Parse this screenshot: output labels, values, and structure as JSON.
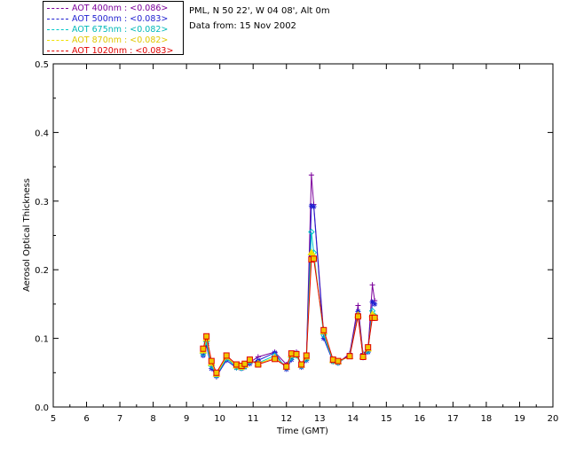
{
  "station": {
    "title": "PML, N 50 22', W 04 08', Alt 0m",
    "date": "Data from: 15 Nov 2002"
  },
  "colors": {
    "400nm": "#7b009b",
    "500nm": "#1f1fd0",
    "675nm": "#00c8c8",
    "870nm": "#f0e000",
    "1020nm": "#e00000"
  },
  "chart_data": {
    "type": "line",
    "xlabel": "Time (GMT)",
    "ylabel": "Aerosol Optical Thickness",
    "xlim": [
      5,
      20
    ],
    "ylim": [
      0.0,
      0.5
    ],
    "x_ticks": [
      "5",
      "6",
      "7",
      "8",
      "9",
      "10",
      "11",
      "12",
      "13",
      "14",
      "15",
      "16",
      "17",
      "18",
      "19",
      "20"
    ],
    "y_ticks": [
      "0.0",
      "0.1",
      "0.2",
      "0.3",
      "0.4",
      "0.5"
    ],
    "x": [
      9.5,
      9.6,
      9.75,
      9.9,
      10.2,
      10.5,
      10.65,
      10.75,
      10.9,
      11.15,
      11.65,
      12.0,
      12.15,
      12.3,
      12.45,
      12.6,
      12.75,
      12.82,
      13.12,
      13.4,
      13.55,
      13.9,
      14.15,
      14.3,
      14.45,
      14.58,
      14.65
    ],
    "series": [
      {
        "name": "AOT  400nm : <0.086>",
        "symbol": "+",
        "values": [
          0.08,
          0.092,
          0.062,
          0.044,
          0.07,
          0.062,
          0.057,
          0.063,
          0.065,
          0.073,
          0.08,
          0.062,
          0.074,
          0.08,
          0.06,
          0.073,
          0.338,
          0.295,
          0.106,
          0.066,
          0.064,
          0.078,
          0.148,
          0.078,
          0.084,
          0.178,
          0.155
        ]
      },
      {
        "name": "AOT  500nm : <0.083>",
        "symbol": "*",
        "values": [
          0.075,
          0.09,
          0.056,
          0.045,
          0.068,
          0.057,
          0.056,
          0.058,
          0.063,
          0.068,
          0.079,
          0.055,
          0.069,
          0.079,
          0.058,
          0.068,
          0.293,
          0.292,
          0.1,
          0.066,
          0.064,
          0.076,
          0.139,
          0.072,
          0.08,
          0.153,
          0.15
        ]
      },
      {
        "name": "AOT  675nm : <0.082>",
        "symbol": "◇",
        "values": [
          0.078,
          0.095,
          0.06,
          0.046,
          0.071,
          0.058,
          0.057,
          0.059,
          0.066,
          0.064,
          0.075,
          0.058,
          0.072,
          0.075,
          0.06,
          0.07,
          0.255,
          0.225,
          0.105,
          0.067,
          0.065,
          0.075,
          0.134,
          0.075,
          0.082,
          0.14,
          0.133
        ]
      },
      {
        "name": "AOT  870nm : <0.082>",
        "symbol": "△",
        "values": [
          0.082,
          0.1,
          0.064,
          0.048,
          0.073,
          0.06,
          0.058,
          0.061,
          0.068,
          0.063,
          0.072,
          0.058,
          0.076,
          0.076,
          0.061,
          0.073,
          0.225,
          0.22,
          0.11,
          0.068,
          0.066,
          0.074,
          0.134,
          0.074,
          0.085,
          0.135,
          0.131
        ]
      },
      {
        "name": "AOT 1020nm : <0.083>",
        "symbol": "□",
        "values": [
          0.085,
          0.103,
          0.067,
          0.05,
          0.075,
          0.062,
          0.06,
          0.063,
          0.069,
          0.062,
          0.07,
          0.059,
          0.078,
          0.077,
          0.062,
          0.075,
          0.215,
          0.216,
          0.112,
          0.069,
          0.067,
          0.074,
          0.132,
          0.073,
          0.087,
          0.13,
          0.13
        ]
      }
    ]
  }
}
